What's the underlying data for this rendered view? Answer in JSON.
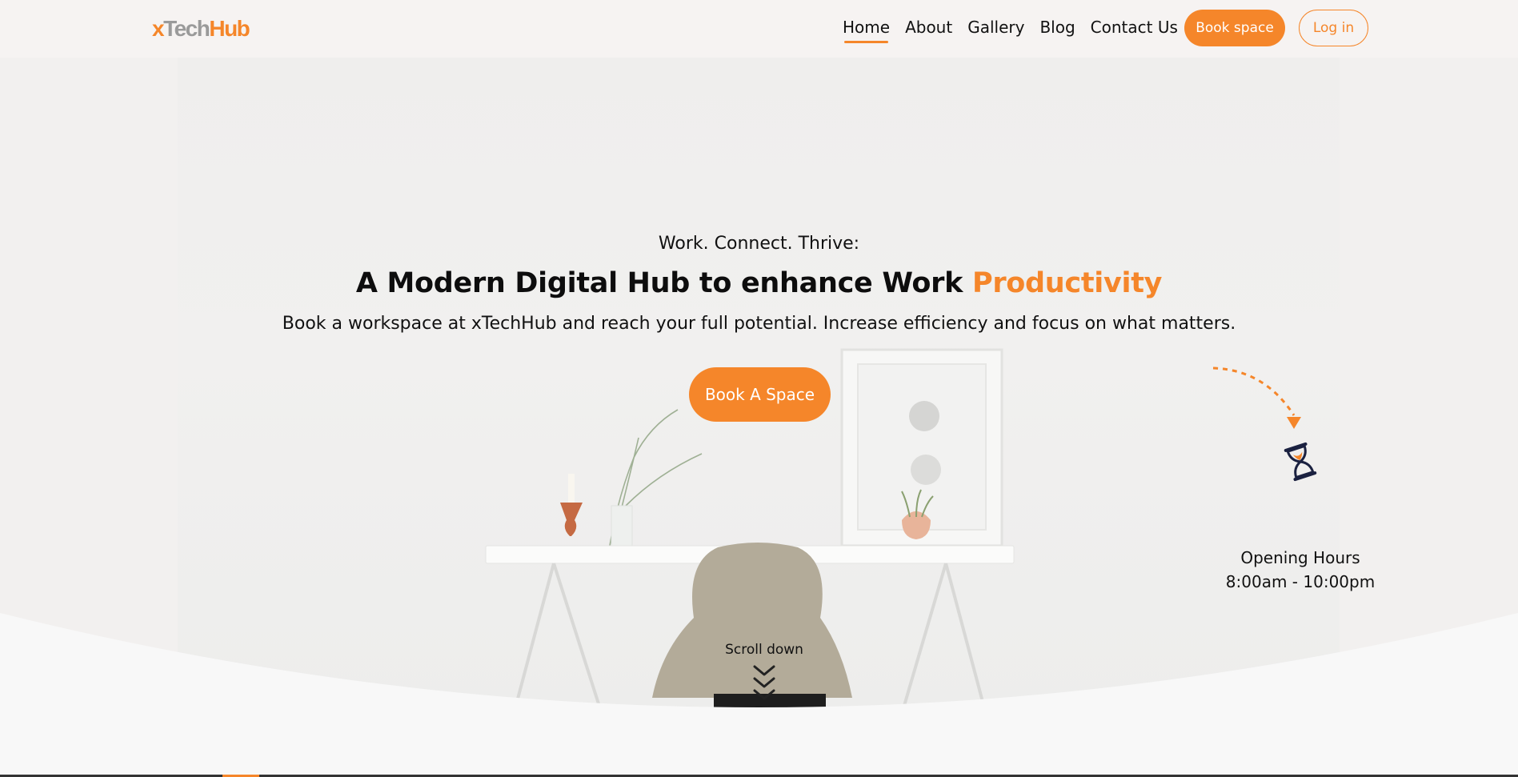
{
  "header": {
    "logo_prefix": "x",
    "logo_mid": "Tech",
    "logo_suffix": "Hub",
    "nav": [
      "Home",
      "About",
      "Gallery",
      "Blog",
      "Contact Us"
    ],
    "active_nav": "Home",
    "book_label": "Book space",
    "login_label": "Log in"
  },
  "hero": {
    "eyebrow": "Work. Connect. Thrive:",
    "headline_main": "A Modern Digital Hub to enhance Work ",
    "headline_accent": "Productivity",
    "subline": "Book a workspace at xTechHub and reach your full potential. Increase efficiency and focus on what matters.",
    "cta_label": "Book A Space"
  },
  "opening": {
    "title": "Opening Hours",
    "hours": "8:00am - 10:00pm"
  },
  "scroll": {
    "label": "Scroll down"
  },
  "colors": {
    "accent": "#f5862a",
    "text": "#111111",
    "background": "#f6f3f2"
  }
}
